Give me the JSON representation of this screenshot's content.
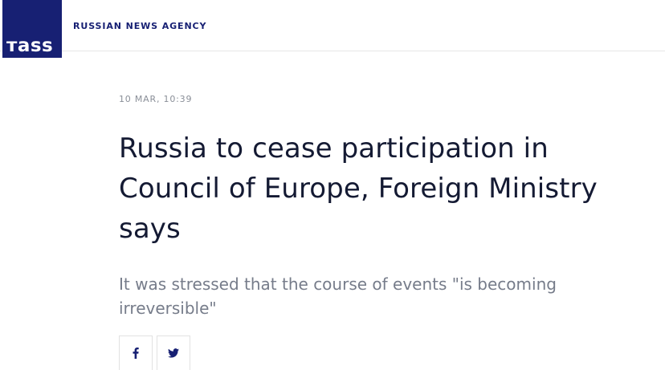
{
  "header": {
    "logo_text": "тass",
    "agency_label": "RUSSIAN NEWS AGENCY"
  },
  "article": {
    "dateline": "10 MAR, 10:39",
    "headline": "Russia to cease participation in Council of Europe, Foreign Ministry says",
    "lead": "It was stressed that the course of events \"is becoming irreversible\""
  },
  "share": {
    "buttons": [
      {
        "icon": "facebook-icon"
      },
      {
        "icon": "twitter-icon"
      }
    ]
  },
  "colors": {
    "brand": "#172073",
    "headline": "#141a33",
    "lead": "#767c8a",
    "dateline": "#8a8f98"
  }
}
